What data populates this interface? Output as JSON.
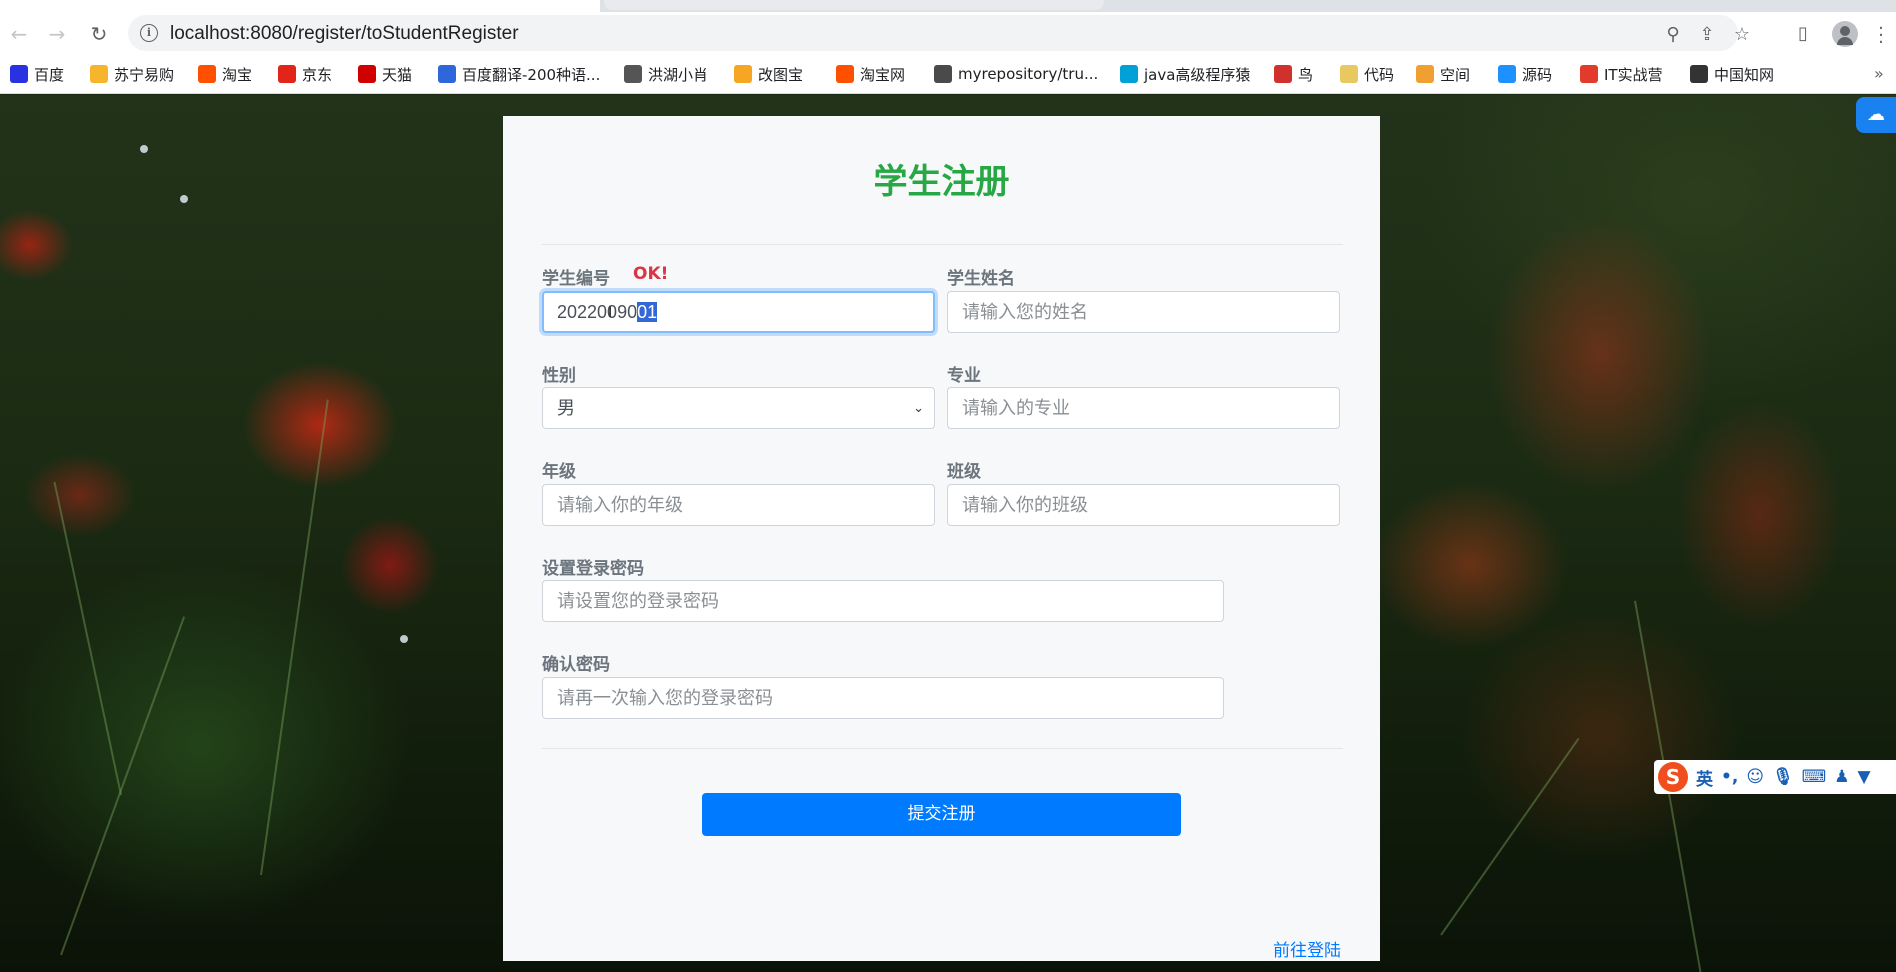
{
  "browser": {
    "url": "localhost:8080/register/toStudentRegister",
    "bookmarks": [
      {
        "label": "百度",
        "color": "#2932e1",
        "icon": "baidu-icon"
      },
      {
        "label": "苏宁易购",
        "color": "#f7b52c",
        "icon": "suning-icon"
      },
      {
        "label": "淘宝",
        "color": "#ff5000",
        "icon": "taobao-icon"
      },
      {
        "label": "京东",
        "color": "#e1251b",
        "icon": "jd-icon"
      },
      {
        "label": "天猫",
        "color": "#d10000",
        "icon": "tmall-icon"
      },
      {
        "label": "百度翻译-200种语...",
        "color": "#2f66d9",
        "icon": "fanyi-icon"
      },
      {
        "label": "洪湖小肖",
        "color": "#555555",
        "icon": "bird-icon"
      },
      {
        "label": "改图宝",
        "color": "#f6a623",
        "icon": "gaitubao-icon"
      },
      {
        "label": "淘宝网",
        "color": "#ff5000",
        "icon": "taobao-icon"
      },
      {
        "label": "myrepository/tru...",
        "color": "#4a4a4a",
        "icon": "chrome-icon"
      },
      {
        "label": "java高级程序猿",
        "color": "#00a1d6",
        "icon": "bilibili-icon"
      },
      {
        "label": "鸟",
        "color": "#d0312d",
        "icon": "bird-icon"
      },
      {
        "label": "代码",
        "color": "#e8c860",
        "icon": "moon-icon"
      },
      {
        "label": "空间",
        "color": "#f0a030",
        "icon": "space-icon"
      },
      {
        "label": "源码",
        "color": "#1e90ff",
        "icon": "fish-icon"
      },
      {
        "label": "IT实战营",
        "color": "#e23b2c",
        "icon": "it-icon"
      },
      {
        "label": "中国知网",
        "color": "#333333",
        "icon": "cnki-icon"
      }
    ]
  },
  "form": {
    "title": "学生注册",
    "student_id": {
      "label": "学生编号",
      "status": "OK!",
      "value_prefix": "20220090",
      "value_selected": "01"
    },
    "student_name": {
      "label": "学生姓名",
      "placeholder": "请输入您的姓名"
    },
    "gender": {
      "label": "性别",
      "selected": "男"
    },
    "major": {
      "label": "专业",
      "placeholder": "请输入的专业"
    },
    "grade": {
      "label": "年级",
      "placeholder": "请输入你的年级"
    },
    "class": {
      "label": "班级",
      "placeholder": "请输入你的班级"
    },
    "password": {
      "label": "设置登录密码",
      "placeholder": "请设置您的登录密码"
    },
    "confirm_password": {
      "label": "确认密码",
      "placeholder": "请再一次输入您的登录密码"
    },
    "submit_label": "提交注册",
    "login_link": "前往登陆"
  },
  "ime": {
    "mode": "英",
    "punct": "•,"
  },
  "colors": {
    "title": "#28a745",
    "ok": "#dc3545",
    "primary": "#007bff",
    "label": "#6c757d"
  }
}
